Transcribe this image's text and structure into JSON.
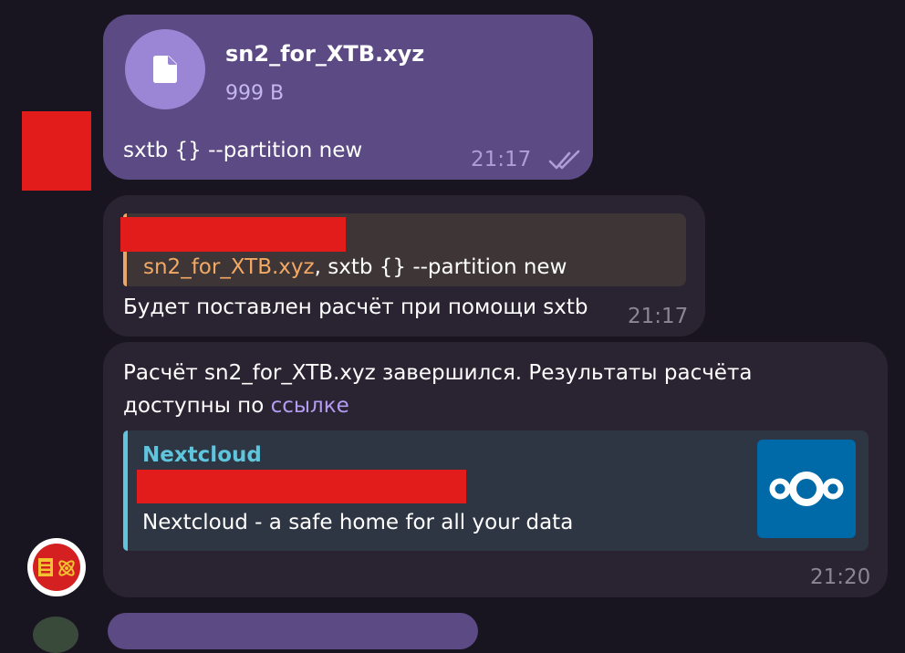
{
  "message_out": {
    "file_name": "sn2_for_XTB.xyz",
    "file_size": "999 B",
    "caption": "sxtb {} --partition new",
    "time": "21:17",
    "status_icon": "double-check-icon"
  },
  "message_in1": {
    "reply_file": "sn2_for_XTB.xyz",
    "reply_rest": ", sxtb {} --partition new",
    "text": "Будет поставлен расчёт при помощи sxtb",
    "time": "21:17"
  },
  "message_in2": {
    "line1": "Расчёт sn2_for_XTB.xyz завершился. Результаты расчёта",
    "line2_prefix": "доступны по ",
    "link_text": "ссылке",
    "preview": {
      "site": "Nextcloud",
      "description": "Nextcloud - a safe home for all your data",
      "thumbnail_icon": "nextcloud-logo-icon"
    },
    "time": "21:20"
  },
  "colors": {
    "background": "#181520",
    "outgoing_bubble": "#5c4a85",
    "incoming_bubble": "#2a2432",
    "link": "#b59cf3",
    "preview_accent": "#5ec5dd",
    "reply_accent": "#e7a76b",
    "redaction": "#e21b1b"
  }
}
